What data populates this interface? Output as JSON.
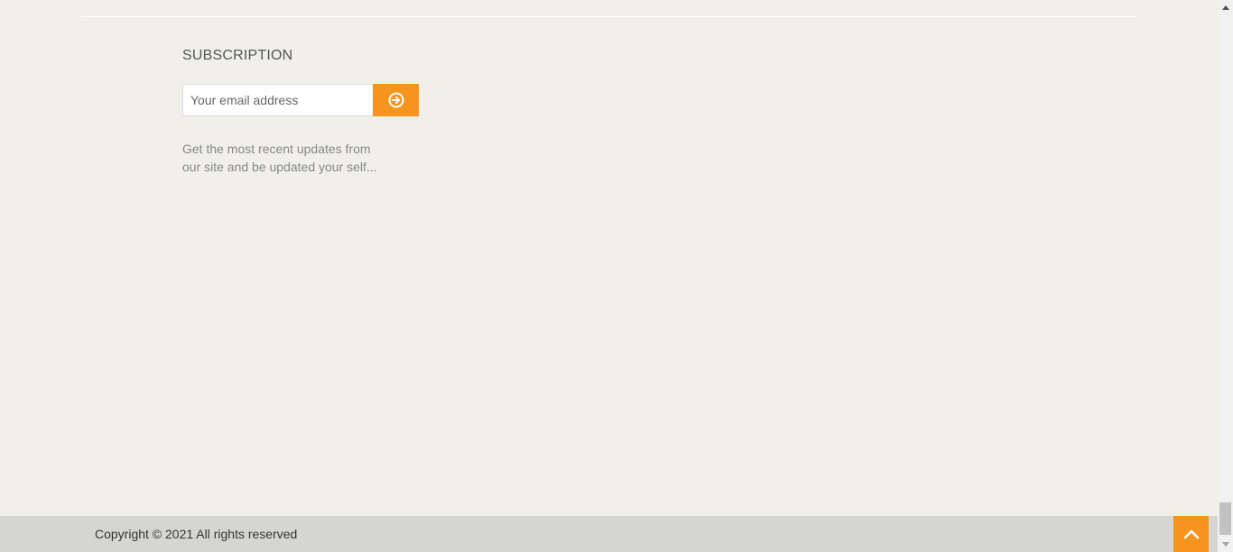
{
  "subscription": {
    "title": "SUBSCRIPTION",
    "email_placeholder": "Your email address",
    "submit_icon": "arrow-circle-right-icon",
    "description": "Get the most recent updates from our site and be updated your self..."
  },
  "footer": {
    "copyright": "Copyright © 2021 All rights reserved",
    "back_to_top_icon": "chevron-up-icon"
  },
  "colors": {
    "background": "#f0efe8",
    "accent": "#f7941d",
    "footer_bar": "#d6d6d0"
  }
}
